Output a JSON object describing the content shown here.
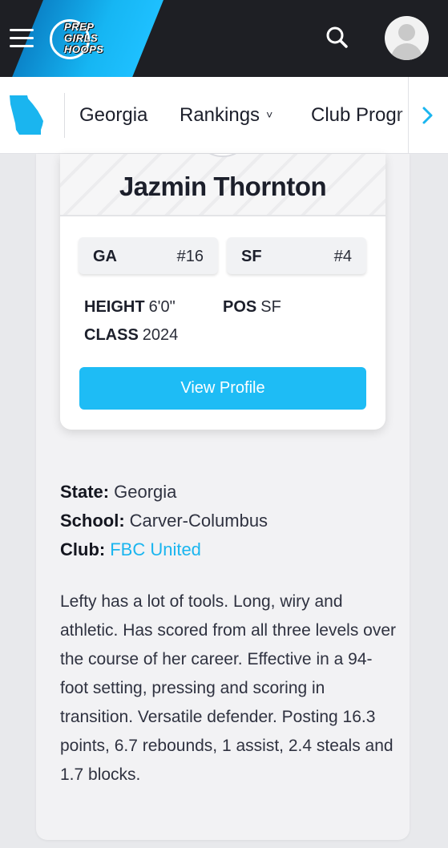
{
  "header": {
    "logo_text": [
      "PREP",
      "GIRLS",
      "HOOPS"
    ]
  },
  "subnav": {
    "items": [
      {
        "label": "Georgia"
      },
      {
        "label": "Rankings",
        "chevron": "˅"
      },
      {
        "label": "Club Progr"
      }
    ]
  },
  "player": {
    "name": "Jazmin Thornton",
    "state_rank": {
      "label": "GA",
      "value": "#16"
    },
    "position_rank": {
      "label": "SF",
      "value": "#4"
    },
    "height_label": "HEIGHT",
    "height_value": "6'0\"",
    "pos_label": "POS",
    "pos_value": "SF",
    "class_label": "CLASS",
    "class_value": "2024",
    "view_profile": "View Profile"
  },
  "details": {
    "state_label": "State:",
    "state_value": "Georgia",
    "school_label": "School:",
    "school_value": "Carver-Columbus",
    "club_label": "Club:",
    "club_value": "FBC United"
  },
  "bio": "Lefty has a lot of tools. Long, wiry and athletic. Has scored from all three levels over the course of her career. Effective in a 94-foot setting, pressing and scoring in transition. Versatile defender. Posting 16.3 points, 6.7 rebounds, 1 assist, 2.4 steals and 1.7 blocks.",
  "colors": {
    "accent": "#1ebcf5",
    "header_bg": "#1e1f24",
    "link": "#1ab5ef"
  },
  "icons": {
    "menu": "hamburger-icon",
    "search": "search-icon",
    "avatar": "user-avatar-icon",
    "state": "georgia-state-icon",
    "scroll_right": "chevron-right-icon"
  }
}
